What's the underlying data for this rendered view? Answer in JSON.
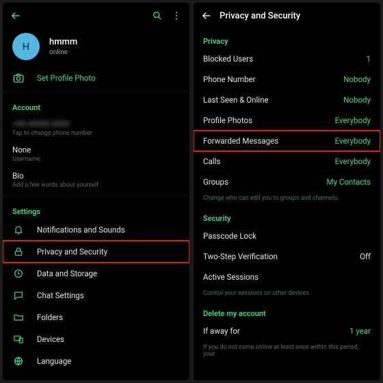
{
  "left": {
    "profile": {
      "avatar_initial": "H",
      "name": "hmmm",
      "status": "online",
      "set_photo_label": "Set Profile Photo"
    },
    "account": {
      "header": "Account",
      "phone_masked": "+00 00000 0000",
      "phone_hint": "Tap to change phone number",
      "username_value": "None",
      "username_hint": "Username",
      "bio_value": "Bio",
      "bio_hint": "Add a few words about yourself"
    },
    "settings": {
      "header": "Settings",
      "items": [
        {
          "label": "Notifications and Sounds"
        },
        {
          "label": "Privacy and Security"
        },
        {
          "label": "Data and Storage"
        },
        {
          "label": "Chat Settings"
        },
        {
          "label": "Folders"
        },
        {
          "label": "Devices"
        },
        {
          "label": "Language"
        }
      ]
    }
  },
  "right": {
    "title": "Privacy and Security",
    "privacy": {
      "header": "Privacy",
      "items": [
        {
          "label": "Blocked Users",
          "value": "1"
        },
        {
          "label": "Phone Number",
          "value": "Nobody"
        },
        {
          "label": "Last Seen & Online",
          "value": "Nobody"
        },
        {
          "label": "Profile Photos",
          "value": "Everybody"
        },
        {
          "label": "Forwarded Messages",
          "value": "Everybody"
        },
        {
          "label": "Calls",
          "value": "Everybody"
        },
        {
          "label": "Groups",
          "value": "My Contacts"
        }
      ],
      "hint": "Change who can add you to groups and channels."
    },
    "security": {
      "header": "Security",
      "items": [
        {
          "label": "Passcode Lock",
          "value": ""
        },
        {
          "label": "Two-Step Verification",
          "value": "Off"
        },
        {
          "label": "Active Sessions",
          "value": ""
        }
      ],
      "hint": "Control your sessions on other devices."
    },
    "delete": {
      "header": "Delete my account",
      "if_away_label": "If away for",
      "if_away_value": "1 year",
      "hint": "If you do not come online at least once within this period, your"
    }
  }
}
